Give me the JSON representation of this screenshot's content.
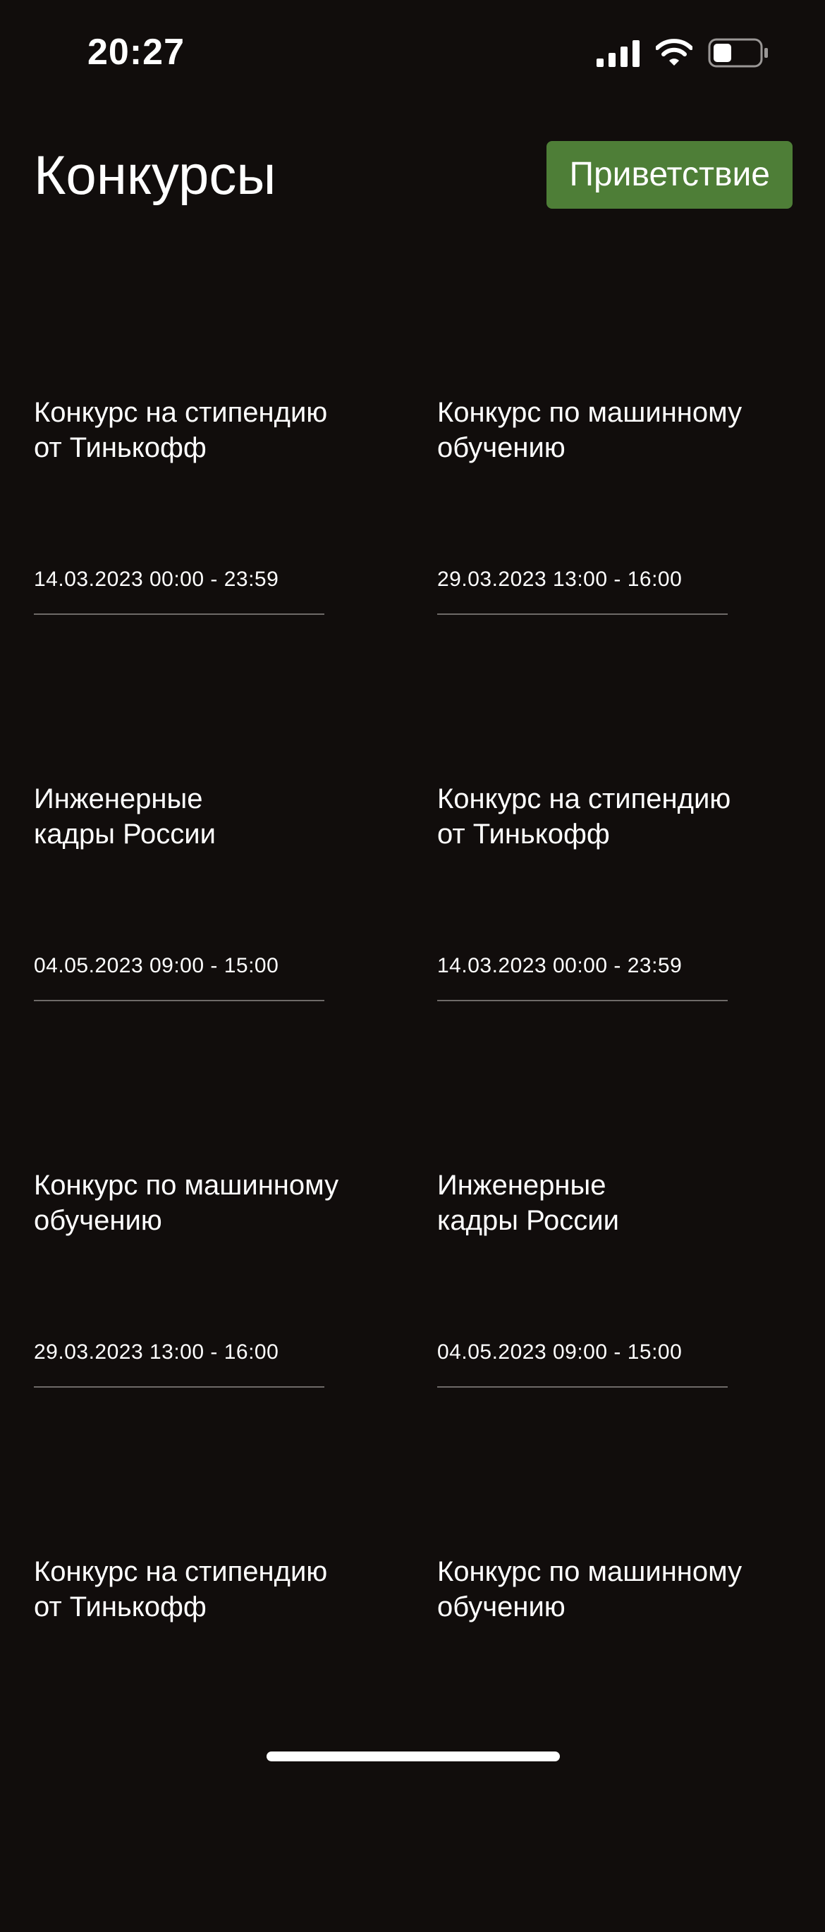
{
  "status_bar": {
    "time": "20:27",
    "icons": [
      "signal-icon",
      "wifi-icon",
      "battery-icon"
    ],
    "battery_level": 0.4
  },
  "header": {
    "title": "Конкурсы",
    "greeting_button": "Приветствие"
  },
  "colors": {
    "background": "#110d0c",
    "accent": "#4e7e37",
    "text": "#ffffff",
    "divider": "#6e6a68"
  },
  "contests": [
    {
      "title": "Конкурс на стипендию\nот Тинькофф",
      "date": "14.03.2023 00:00 - 23:59"
    },
    {
      "title": "Конкурс по машинному\nобучению",
      "date": "29.03.2023 13:00 - 16:00"
    },
    {
      "title": "Инженерные\nкадры России",
      "date": "04.05.2023 09:00 - 15:00"
    },
    {
      "title": "Конкурс на стипендию\nот Тинькофф",
      "date": "14.03.2023 00:00 - 23:59"
    },
    {
      "title": "Конкурс по машинному\nобучению",
      "date": "29.03.2023 13:00 - 16:00"
    },
    {
      "title": "Инженерные\nкадры России",
      "date": "04.05.2023 09:00 - 15:00"
    },
    {
      "title": "Конкурс на стипендию\nот Тинькофф",
      "date": ""
    },
    {
      "title": "Конкурс по машинному\nобучению",
      "date": ""
    }
  ]
}
